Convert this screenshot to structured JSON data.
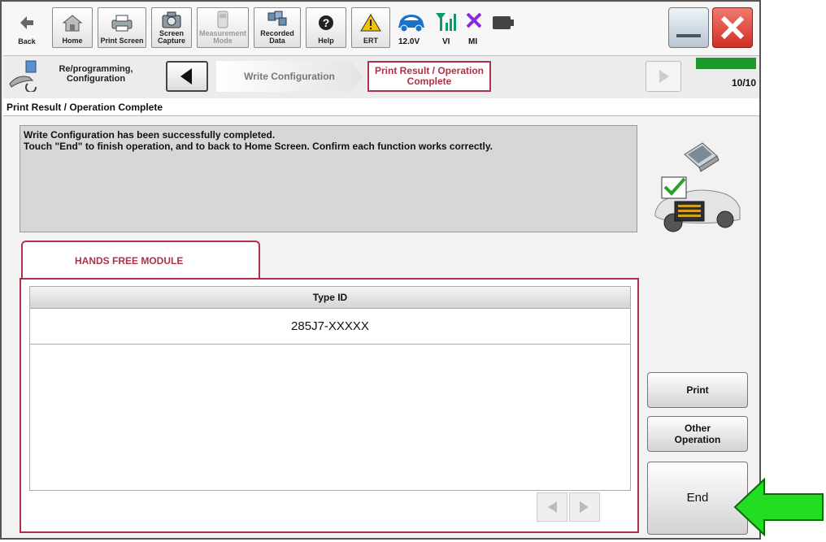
{
  "toolbar": {
    "back": "Back",
    "home": "Home",
    "print_screen": "Print Screen",
    "screen_capture": "Screen Capture",
    "measurement_mode": "Measurement Mode",
    "recorded_data": "Recorded Data",
    "help": "Help",
    "ert": "ERT",
    "voltage": "12.0V",
    "vi": "VI",
    "mi": "MI"
  },
  "steps": {
    "mode_label": "Re/programming, Configuration",
    "previous": "Write Configuration",
    "current": "Print Result / Operation Complete",
    "progress_label": "10/10",
    "progress_fraction": 1.0
  },
  "page_title": "Print Result / Operation Complete",
  "message": {
    "line1": "Write Configuration has been successfully completed.",
    "line2": "Touch \"End\" to finish operation, and to back to Home Screen. Confirm each function works correctly."
  },
  "tab_label": "HANDS FREE MODULE",
  "table": {
    "header": "Type ID",
    "value": "285J7-XXXXX"
  },
  "buttons": {
    "print": "Print",
    "other_operation": "Other Operation",
    "end": "End"
  },
  "colors": {
    "accent": "#b0304a",
    "progress": "#1e9a2d",
    "callout_arrow": "#22dd22",
    "close": "#e0453d"
  }
}
